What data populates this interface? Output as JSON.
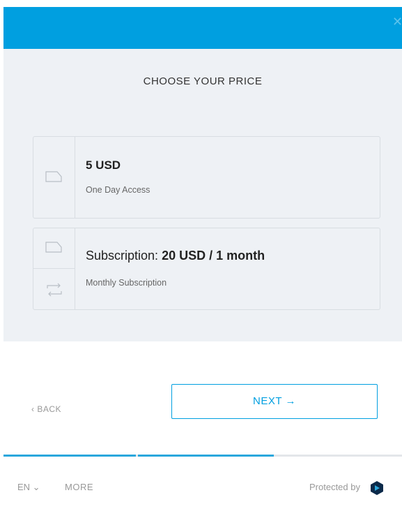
{
  "header": {
    "close_glyph": "✕"
  },
  "pricing": {
    "title": "CHOOSE YOUR PRICE",
    "options": [
      {
        "price_prefix": "",
        "price": "5 USD",
        "description": "One Day Access",
        "icon": "price-tag-icon"
      },
      {
        "price_prefix": "Subscription: ",
        "price": "20 USD / 1 month",
        "description": "Monthly Subscription",
        "icon": "price-tag-icon",
        "icon2": "repeat-icon"
      }
    ]
  },
  "nav": {
    "back_label": "‹ BACK",
    "next_label": "NEXT →"
  },
  "progress": {
    "steps_total": 3,
    "steps_completed": 2
  },
  "footer": {
    "language": "EN ⌄",
    "more_label": "MORE",
    "protected_label": "Protected by"
  },
  "colors": {
    "accent": "#009fe0",
    "panel": "#eef1f5",
    "border": "#d8dde2"
  }
}
